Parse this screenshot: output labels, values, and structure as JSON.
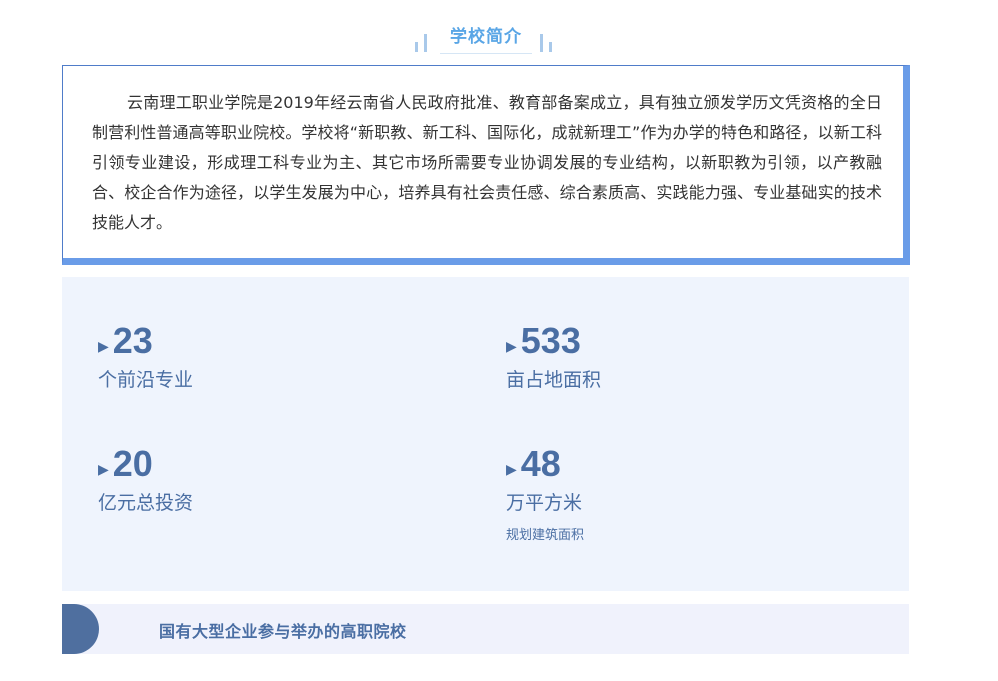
{
  "section_title": "学校简介",
  "intro": {
    "text": "云南理工职业学院是2019年经云南省人民政府批准、教育部备案成立，具有独立颁发学历文凭资格的全日制营利性普通高等职业院校。学校将“新职教、新工科、国际化，成就新理工”作为办学的特色和路径，以新工科引领专业建设，形成理工科专业为主、其它市场所需要专业协调发展的专业结构，以新职教为引领，以产教融合、校企合作为途径，以学生发展为中心，培养具有社会责任感、综合素质高、实践能力强、专业基础实的技术技能人才。"
  },
  "stats": [
    {
      "arrow": "▶",
      "value": "23",
      "label": "个前沿专业",
      "note": ""
    },
    {
      "arrow": "▶",
      "value": "533",
      "label": "亩占地面积",
      "note": ""
    },
    {
      "arrow": "▶",
      "value": "20",
      "label": "亿元总投资",
      "note": ""
    },
    {
      "arrow": "▶",
      "value": "48",
      "label": "万平方米",
      "note": "规划建筑面积"
    }
  ],
  "banner": {
    "text": "国有大型企业参与举办的高职院校"
  },
  "colors": {
    "title": "#5aa6e6",
    "accent": "#4a6ea3",
    "box_border": "#6a9ce8",
    "panel_bg": "#eff4fd",
    "banner_bg": "#f0f2fc",
    "banner_circle": "#4f6f9f"
  }
}
